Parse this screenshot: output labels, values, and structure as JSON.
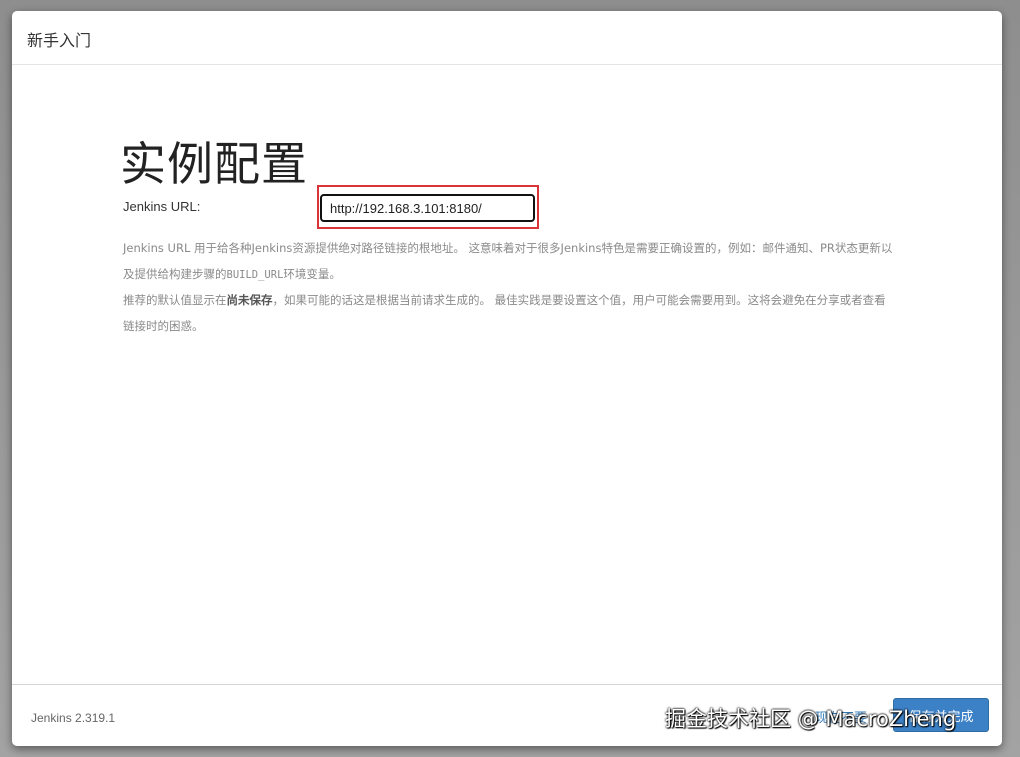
{
  "dialog": {
    "title": "新手入门"
  },
  "main": {
    "heading": "实例配置",
    "url_label": "Jenkins URL:",
    "url_value": "http://192.168.3.101:8180/",
    "help": {
      "p1_part1": "Jenkins URL 用于给各种Jenkins资源提供绝对路径链接的根地址。 这意味着对于很多Jenkins特色是需要正确设置的，例如：邮件通知、PR状态更新以及提供给构建步骤的",
      "p1_code": "BUILD_URL",
      "p1_part2": "环境变量。",
      "p2_part1": "推荐的默认值显示在",
      "p2_strong": "尚未保存",
      "p2_part2": "，如果可能的话这是根据当前请求生成的。 最佳实践是要设置这个值，用户可能会需要用到。这将会避免在分享或者查看链接时的困惑。"
    }
  },
  "footer": {
    "version": "Jenkins 2.319.1",
    "skip_label": "现在不要",
    "save_label": "保存并完成"
  },
  "watermark": "掘金技术社区 @ MacroZheng",
  "colors": {
    "highlight": "#d9343a",
    "primary_button": "#3c80c6",
    "link": "#337ab7"
  }
}
